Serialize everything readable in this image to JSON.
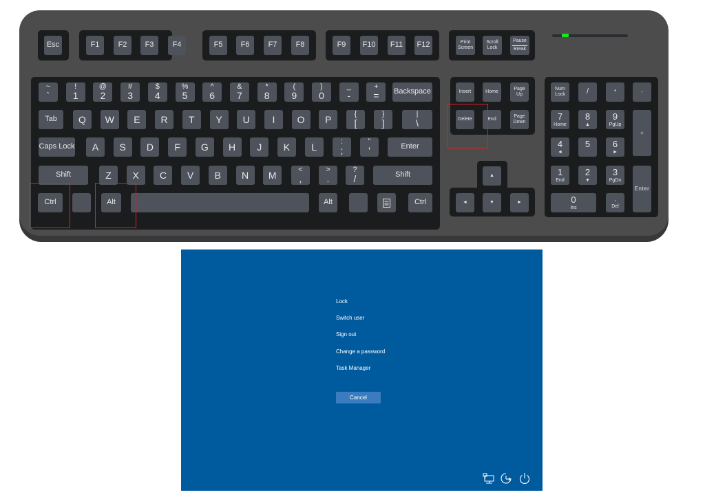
{
  "keyboard": {
    "function_row": {
      "esc": "Esc",
      "f_keys": [
        "F1",
        "F2",
        "F3",
        "F4",
        "F5",
        "F6",
        "F7",
        "F8",
        "F9",
        "F10",
        "F11",
        "F12"
      ],
      "print_screen": [
        "Print",
        "Screen"
      ],
      "scroll_lock": [
        "Scroll",
        "Lock"
      ],
      "pause_break": [
        "Pause",
        "Break"
      ]
    },
    "indicator": {
      "active_led_color": "#19e619"
    },
    "number_row": [
      {
        "top": "~",
        "bot": "`"
      },
      {
        "top": "!",
        "bot": "1"
      },
      {
        "top": "@",
        "bot": "2"
      },
      {
        "top": "#",
        "bot": "3"
      },
      {
        "top": "$",
        "bot": "4"
      },
      {
        "top": "%",
        "bot": "5"
      },
      {
        "top": "^",
        "bot": "6"
      },
      {
        "top": "&",
        "bot": "7"
      },
      {
        "top": "*",
        "bot": "8"
      },
      {
        "top": "(",
        "bot": "9"
      },
      {
        "top": ")",
        "bot": "0"
      },
      {
        "top": "_",
        "bot": "-"
      },
      {
        "top": "+",
        "bot": "="
      }
    ],
    "backspace": "Backspace",
    "tab": "Tab",
    "qwerty_row": [
      "Q",
      "W",
      "E",
      "R",
      "T",
      "Y",
      "U",
      "I",
      "O",
      "P"
    ],
    "brackets": [
      {
        "top": "{",
        "bot": "["
      },
      {
        "top": "}",
        "bot": "]"
      },
      {
        "top": "|",
        "bot": "\\"
      }
    ],
    "caps_lock": "Caps Lock",
    "home_row": [
      "A",
      "S",
      "D",
      "F",
      "G",
      "H",
      "J",
      "K",
      "L"
    ],
    "home_punct": [
      {
        "top": ":",
        "bot": ";"
      },
      {
        "top": "\"",
        "bot": "'"
      }
    ],
    "enter": "Enter",
    "shift": "Shift",
    "bottom_letters": [
      "Z",
      "X",
      "C",
      "V",
      "B",
      "N",
      "M"
    ],
    "bottom_punct": [
      {
        "top": "<",
        "bot": ","
      },
      {
        "top": ">",
        "bot": "."
      },
      {
        "top": "?",
        "bot": "/"
      }
    ],
    "ctrl": "Ctrl",
    "alt": "Alt",
    "nav": {
      "insert": "Insert",
      "home": "Home",
      "page_up": [
        "Page",
        "Up"
      ],
      "delete": "Delete",
      "end": "End",
      "page_down": [
        "Page",
        "Down"
      ]
    },
    "arrows": {
      "up": "▲",
      "left": "◄",
      "down": "▼",
      "right": "►"
    },
    "numpad": {
      "num_lock": [
        "Num",
        "Lock"
      ],
      "divide": "/",
      "multiply": "*",
      "minus": "-",
      "plus": "+",
      "enter": "Enter",
      "seven": {
        "top": "7",
        "bot": "Home"
      },
      "eight": {
        "top": "8",
        "bot": "▲"
      },
      "nine": {
        "top": "9",
        "bot": "PgUp"
      },
      "four": {
        "top": "4",
        "bot": "◄"
      },
      "five": {
        "top": "5",
        "bot": ""
      },
      "six": {
        "top": "6",
        "bot": "►"
      },
      "one": {
        "top": "1",
        "bot": "End"
      },
      "two": {
        "top": "2",
        "bot": "▼"
      },
      "three": {
        "top": "3",
        "bot": "PgDn"
      },
      "zero": {
        "top": "0",
        "bot": "Ins"
      },
      "decimal": {
        "top": ",",
        "bot": "Del"
      }
    },
    "highlighted_keys": [
      "Ctrl",
      "Alt",
      "Delete"
    ],
    "highlight_color": "#e02020"
  },
  "security_screen": {
    "background_color": "#005a9e",
    "options": [
      "Lock",
      "Switch user",
      "Sign out",
      "Change a password",
      "Task Manager"
    ],
    "cancel_label": "Cancel",
    "icons": [
      "network-icon",
      "ease-of-access-icon",
      "power-icon"
    ]
  }
}
